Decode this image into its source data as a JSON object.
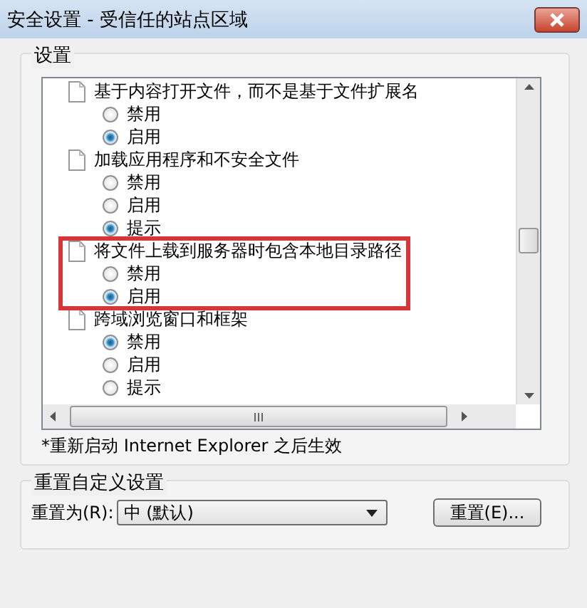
{
  "window": {
    "title": "安全设置 - 受信任的站点区域"
  },
  "settings": {
    "label": "设置",
    "items": [
      {
        "label": "基于内容打开文件，而不是基于文件扩展名",
        "highlighted": false,
        "options": [
          {
            "label": "禁用",
            "selected": false
          },
          {
            "label": "启用",
            "selected": true
          }
        ]
      },
      {
        "label": "加载应用程序和不安全文件",
        "highlighted": false,
        "options": [
          {
            "label": "禁用",
            "selected": false
          },
          {
            "label": "启用",
            "selected": false
          },
          {
            "label": "提示",
            "selected": true
          }
        ]
      },
      {
        "label": "将文件上载到服务器时包含本地目录路径",
        "highlighted": true,
        "options": [
          {
            "label": "禁用",
            "selected": false
          },
          {
            "label": "启用",
            "selected": true
          }
        ]
      },
      {
        "label": "跨域浏览窗口和框架",
        "highlighted": false,
        "options": [
          {
            "label": "禁用",
            "selected": true
          },
          {
            "label": "启用",
            "selected": false
          },
          {
            "label": "提示",
            "selected": false
          }
        ]
      }
    ],
    "note": "*重新启动 Internet Explorer 之后生效"
  },
  "reset": {
    "label": "重置自定义设置",
    "field_label": "重置为(R):",
    "value": "中 (默认)",
    "button": "重置(E)..."
  }
}
